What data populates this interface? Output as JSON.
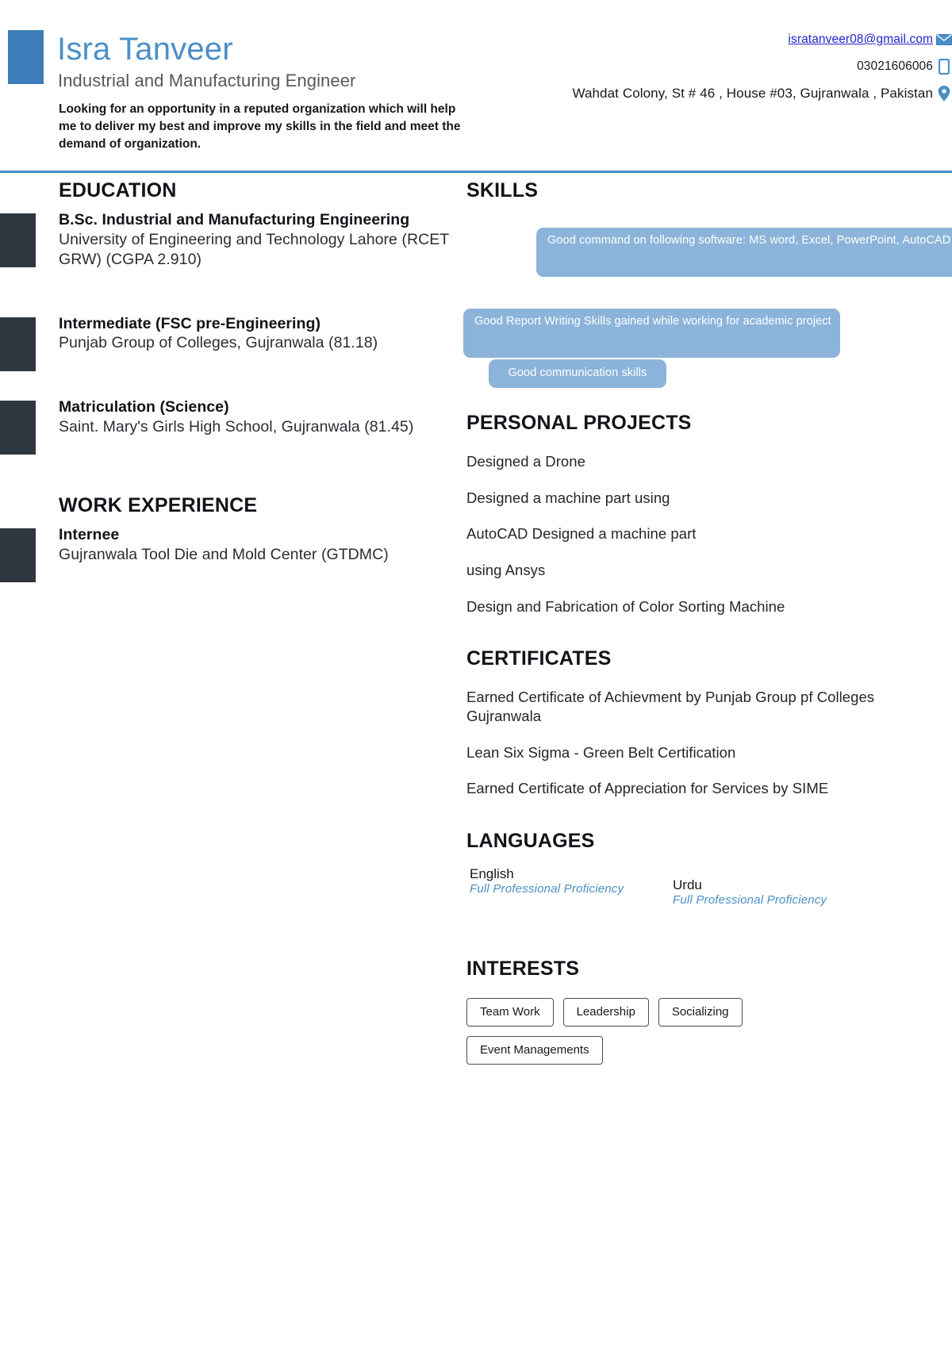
{
  "colors": {
    "accent_blue": "#4a8fc7",
    "header_bar_blue": "#3d7cb8",
    "entry_bar_dark": "#2e3640",
    "pill_blue": "#8cb4da",
    "link_blue": "#2222cc"
  },
  "header": {
    "name": "Isra Tanveer",
    "job_title": "Industrial and Manufacturing Engineer",
    "summary": "Looking for an opportunity in a reputed organization which will help me to deliver my best and improve my skills in the field and meet the demand of organization.",
    "contact": {
      "email": "isratanveer08@gmail.com",
      "email_icon": "envelope-icon",
      "phone": "03021606006",
      "phone_icon": "phone-icon",
      "address": "Wahdat Colony, St # 46 , House #03, Gujranwala , Pakistan",
      "address_icon": "location-pin-icon"
    }
  },
  "education": {
    "heading": "EDUCATION",
    "entries": [
      {
        "degree": "B.Sc. Industrial and Manufacturing Engineering",
        "institution": "University of Engineering and Technology Lahore (RCET GRW) (CGPA 2.910)"
      },
      {
        "degree": "Intermediate  (FSC  pre-Engineering)",
        "institution": "Punjab Group of Colleges, Gujranwala (81.18)"
      },
      {
        "degree": "Matriculation (Science)",
        "institution": "Saint. Mary's Girls High School, Gujranwala (81.45)"
      }
    ]
  },
  "work_experience": {
    "heading": "WORK EXPERIENCE",
    "entries": [
      {
        "role": "Internee",
        "company": "Gujranwala Tool Die and Mold Center (GTDMC)"
      }
    ]
  },
  "skills": {
    "heading": "SKILLS",
    "pills": [
      "Good command on following software: MS word, Excel, PowerPoint, AutoCAD",
      "Good Report Writing Skills gained while working for academic project",
      "Good communication skills"
    ]
  },
  "personal_projects": {
    "heading": "PERSONAL PROJECTS",
    "items": [
      "Designed a Drone",
      "Designed a machine part using",
      "AutoCAD Designed a machine part",
      "using Ansys",
      "Design and Fabrication of Color Sorting Machine"
    ]
  },
  "certificates": {
    "heading": "CERTIFICATES",
    "items": [
      "Earned Certificate of Achievment by Punjab Group pf Colleges Gujranwala",
      "Lean Six Sigma - Green Belt Certification",
      "Earned Certificate of Appreciation for Services by SIME"
    ]
  },
  "languages": {
    "heading": "LANGUAGES",
    "items": [
      {
        "name": "English",
        "level": "Full Professional Proficiency"
      },
      {
        "name": "Urdu",
        "level": "Full Professional Proficiency"
      }
    ]
  },
  "interests": {
    "heading": "INTERESTS",
    "items": [
      "Team Work",
      "Leadership",
      "Socializing",
      "Event Managements"
    ]
  }
}
